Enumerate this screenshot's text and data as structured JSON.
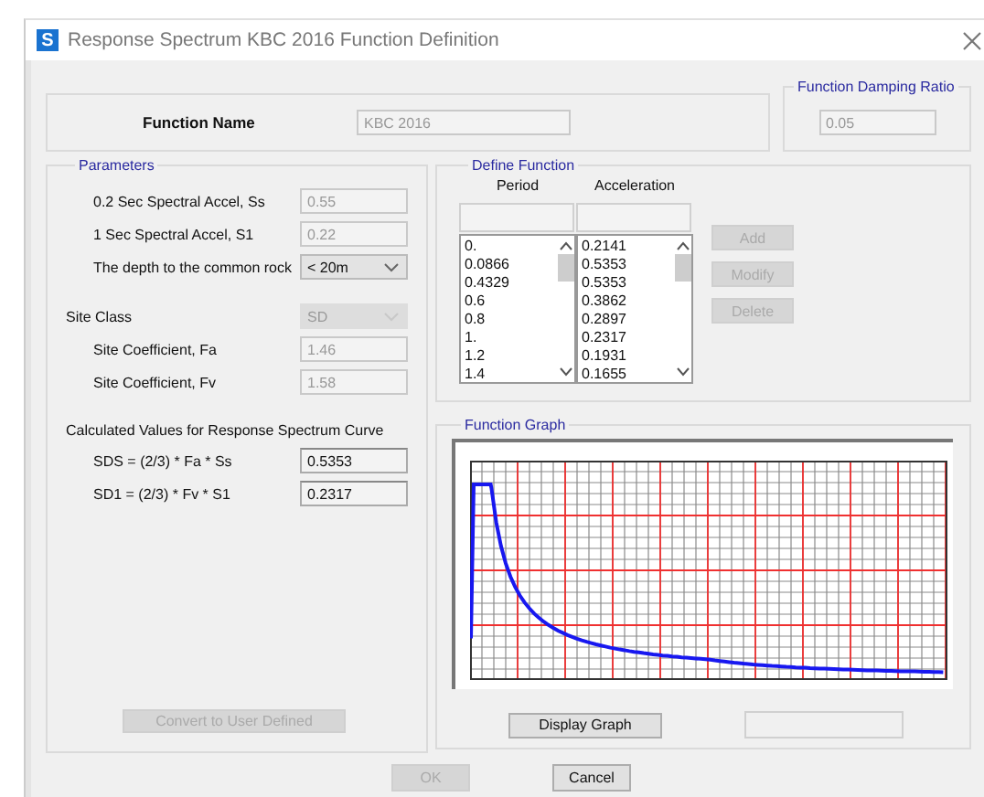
{
  "window": {
    "title": "Response Spectrum KBC 2016 Function Definition",
    "icon_letter": "S"
  },
  "function_name": {
    "label": "Function Name",
    "value": "KBC 2016",
    "disabled": true
  },
  "damping": {
    "title": "Function Damping Ratio",
    "value": "0.05",
    "disabled": true
  },
  "parameters": {
    "title": "Parameters",
    "rows": [
      {
        "kind": "field",
        "label": "0.2 Sec Spectral Accel, Ss",
        "value": "0.55",
        "disabled": true
      },
      {
        "kind": "field",
        "label": "1 Sec Spectral Accel, S1",
        "value": "0.22",
        "disabled": true
      },
      {
        "kind": "dropdown",
        "label": "The depth to the common rock",
        "value": "< 20m",
        "disabled": false
      }
    ],
    "site_class": {
      "label": "Site Class",
      "value": "SD",
      "disabled": true
    },
    "site_rows": [
      {
        "label": "Site Coefficient, Fa",
        "value": "1.46",
        "disabled": true
      },
      {
        "label": "Site Coefficient, Fv",
        "value": "1.58",
        "disabled": true
      }
    ],
    "calculated": {
      "title": "Calculated Values for Response Spectrum Curve",
      "rows": [
        {
          "label": "SDS = (2/3) * Fa * Ss",
          "value": "0.5353",
          "disabled": false
        },
        {
          "label": "SD1 = (2/3) * Fv * S1",
          "value": "0.2317",
          "disabled": false
        }
      ]
    },
    "convert_button": {
      "label": "Convert to User Defined",
      "disabled": true
    }
  },
  "define_function": {
    "title": "Define Function",
    "columns": [
      {
        "heading": "Period",
        "values": [
          "0.",
          "0.0866",
          "0.4329",
          "0.6",
          "0.8",
          "1.",
          "1.2",
          "1.4"
        ]
      },
      {
        "heading": "Acceleration",
        "values": [
          "0.2141",
          "0.5353",
          "0.5353",
          "0.3862",
          "0.2897",
          "0.2317",
          "0.1931",
          "0.1655"
        ]
      }
    ],
    "buttons": [
      {
        "label": "Add",
        "disabled": true
      },
      {
        "label": "Modify",
        "disabled": true
      },
      {
        "label": "Delete",
        "disabled": true
      }
    ]
  },
  "function_graph": {
    "title": "Function Graph",
    "display_button": "Display Graph"
  },
  "footer_buttons": [
    {
      "label": "OK",
      "disabled": true
    },
    {
      "label": "Cancel",
      "disabled": false
    }
  ]
}
